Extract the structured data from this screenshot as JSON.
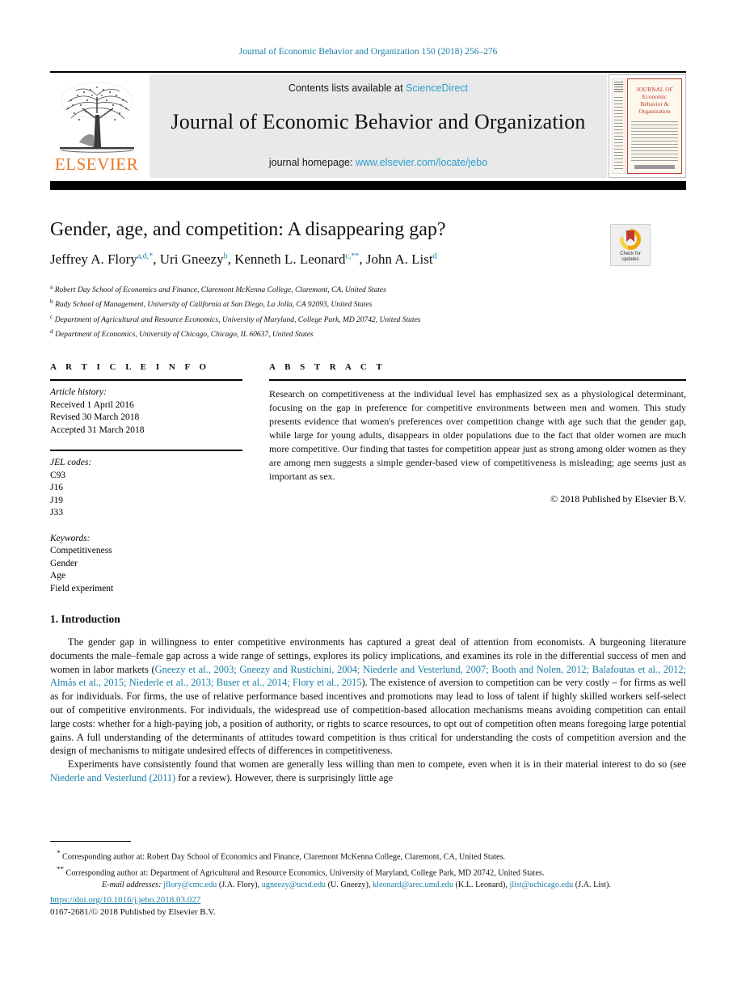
{
  "running_head": "Journal of Economic Behavior and Organization 150 (2018) 256–276",
  "masthead": {
    "contents_prefix": "Contents lists available at ",
    "contents_link": "ScienceDirect",
    "journal_name": "Journal of Economic Behavior and Organization",
    "homepage_prefix": "journal homepage: ",
    "homepage_link": "www.elsevier.com/locate/jebo",
    "publisher_wordmark": "ELSEVIER",
    "cover_title_line1": "JOURNAL OF",
    "cover_title_line2": "Economic",
    "cover_title_line3": "Behavior &",
    "cover_title_line4": "Organization"
  },
  "crossmark": {
    "line1": "Check for",
    "line2": "updates"
  },
  "article": {
    "title": "Gender, age, and competition: A disappearing gap?",
    "authors_html": "Jeffrey A. Flory<sup>a,d,*</sup>, Uri Gneezy<sup>b</sup>, Kenneth L. Leonard<sup>c,**</sup>, John A. List<sup>d</sup>",
    "affiliations": [
      {
        "mark": "a",
        "text": "Robert Day School of Economics and Finance, Claremont McKenna College, Claremont, CA, United States"
      },
      {
        "mark": "b",
        "text": "Rady School of Management, University of California at San Diego, La Jolla, CA 92093, United States"
      },
      {
        "mark": "c",
        "text": "Department of Agricultural and Resource Economics, University of Maryland, College Park, MD 20742, United States"
      },
      {
        "mark": "d",
        "text": "Department of Economics, University of Chicago, Chicago, IL 60637, United States"
      }
    ]
  },
  "article_info": {
    "heading": "A R T I C L E   I N F O",
    "history_label": "Article history:",
    "history": [
      "Received 1 April 2016",
      "Revised 30 March 2018",
      "Accepted 31 March 2018"
    ],
    "jel_label": "JEL codes:",
    "jel_codes": [
      "C93",
      "J16",
      "J19",
      "J33"
    ],
    "keywords_label": "Keywords:",
    "keywords": [
      "Competitiveness",
      "Gender",
      "Age",
      "Field experiment"
    ]
  },
  "abstract": {
    "heading": "A B S T R A C T",
    "text": "Research on competitiveness at the individual level has emphasized sex as a physiological determinant, focusing on the gap in preference for competitive environments between men and women. This study presents evidence that women's preferences over competition change with age such that the gender gap, while large for young adults, disappears in older populations due to the fact that older women are much more competitive. Our finding that tastes for competition appear just as strong among older women as they are among men suggests a simple gender-based view of competitiveness is misleading; age seems just as important as sex.",
    "copyright": "© 2018 Published by Elsevier B.V."
  },
  "body": {
    "section_number_title": "1. Introduction",
    "paragraph1_part1": "The gender gap in willingness to enter competitive environments has captured a great deal of attention from economists. A burgeoning literature documents the male–female gap across a wide range of settings, explores its policy implications, and examines its role in the differential success of men and women in labor markets (",
    "paragraph1_citations": "Gneezy et al., 2003; Gneezy and Rustichini, 2004; Niederle and Vesterlund, 2007; Booth and Nolen, 2012; Balafoutas et al., 2012; Almås et al., 2015; Niederle et al., 2013; Buser et al., 2014; Flory et al., 2015",
    "paragraph1_part2": "). The existence of aversion to competition can be very costly – for firms as well as for individuals. For firms, the use of relative performance based incentives and promotions may lead to loss of talent if highly skilled workers self-select out of competitive environments. For individuals, the widespread use of competition-based allocation mechanisms means avoiding competition can entail large costs: whether for a high-paying job, a position of authority, or rights to scarce resources, to opt out of competition often means foregoing large potential gains. A full understanding of the determinants of attitudes toward competition is thus critical for understanding the costs of competition aversion and the design of mechanisms to mitigate undesired effects of differences in competitiveness.",
    "paragraph2_part1": "Experiments have consistently found that women are generally less willing than men to compete, even when it is in their material interest to do so (see ",
    "paragraph2_citation": "Niederle and Vesterlund (2011)",
    "paragraph2_part2": " for a review). However, there is surprisingly little age"
  },
  "footnotes": {
    "note1_mark": "*",
    "note1": "Corresponding author at: Robert Day School of Economics and Finance, Claremont McKenna College, Claremont, CA, United States.",
    "note2_mark": "**",
    "note2": "Corresponding author at: Department of Agricultural and Resource Economics, University of Maryland, College Park, MD 20742, United States.",
    "emails_label": "E-mail addresses:",
    "emails": [
      {
        "address": "jflory@cmc.edu",
        "owner": "(J.A. Flory),"
      },
      {
        "address": "ugneezy@ucsd.edu",
        "owner": "(U. Gneezy),"
      },
      {
        "address": "kleonard@arec.umd.edu",
        "owner": "(K.L. Leonard),"
      },
      {
        "address": "jlist@uchicago.edu",
        "owner": "(J.A. List)."
      }
    ],
    "doi": "https://doi.org/10.1016/j.jebo.2018.03.027",
    "issn_copyright": "0167-2681/© 2018 Published by Elsevier B.V."
  },
  "colors": {
    "link_blue": "#1b7fa8",
    "sciencedirect_blue": "#2a9fd0",
    "elsevier_orange": "#e87722",
    "cover_red": "#c0392b"
  }
}
